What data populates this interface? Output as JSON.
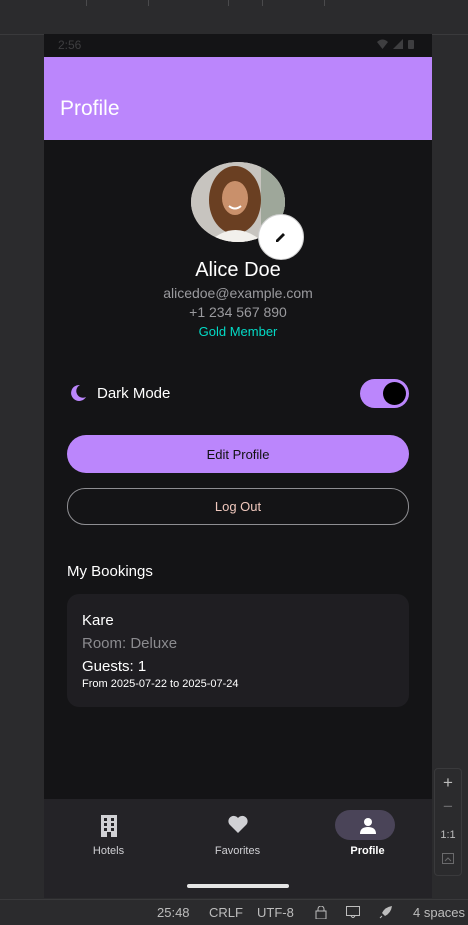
{
  "status_bar": {
    "time": "2:56"
  },
  "app_bar": {
    "title": "Profile"
  },
  "profile": {
    "name": "Alice Doe",
    "email": "alicedoe@example.com",
    "phone": "+1 234 567 890",
    "membership": "Gold Member"
  },
  "settings": {
    "dark_mode_label": "Dark Mode",
    "dark_mode_on": true
  },
  "actions": {
    "edit_profile_label": "Edit Profile",
    "logout_label": "Log Out"
  },
  "bookings": {
    "section_title": "My Bookings",
    "items": [
      {
        "hotel": "Kare",
        "room": "Room: Deluxe",
        "guests": "Guests: 1",
        "dates": "From 2025-07-22 to 2025-07-24"
      }
    ]
  },
  "bottom_nav": {
    "items": [
      {
        "label": "Hotels",
        "icon": "hotel-icon"
      },
      {
        "label": "Favorites",
        "icon": "heart-icon"
      },
      {
        "label": "Profile",
        "icon": "person-icon",
        "active": true
      }
    ]
  },
  "emulator_zoom": {
    "one_to_one": "1:1"
  },
  "ide_status": {
    "position": "25:48",
    "line_ending": "CRLF",
    "encoding": "UTF-8",
    "indent": "4 spaces"
  },
  "colors": {
    "accent": "#bb86fc",
    "secondary": "#03dac6",
    "background": "#141416",
    "card": "#1f1e22"
  }
}
